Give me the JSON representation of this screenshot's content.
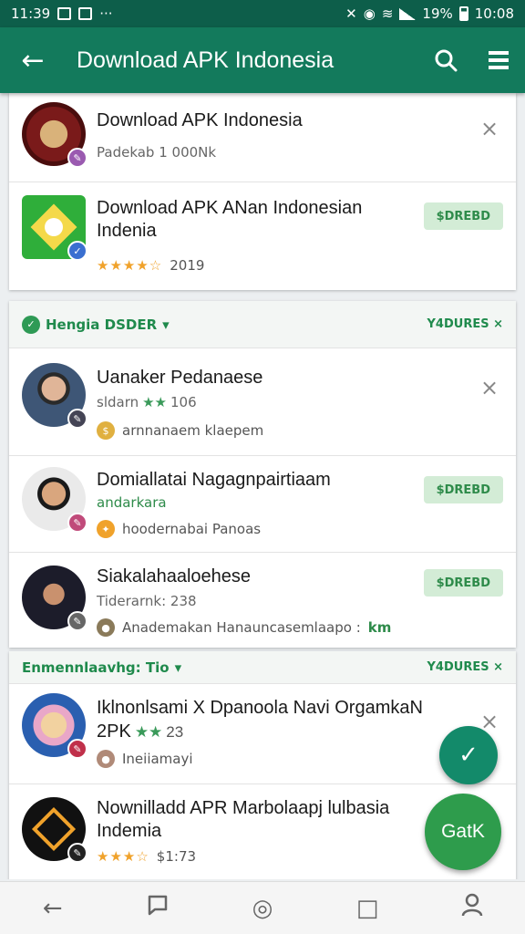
{
  "status": {
    "time": "11:39",
    "more": "···",
    "battery": "19%",
    "time_right": "10:08"
  },
  "appbar": {
    "back": "←",
    "title": "Download APK Indonesia",
    "search_icon": "search-icon",
    "menu_icon": "menu-icon"
  },
  "top_items": [
    {
      "title": "Download APK Indonesia",
      "sub": "Padekab 1 000Nk",
      "action": "×"
    },
    {
      "title": "Download APK ANan Indonesian Indenia",
      "rating_text": "2019",
      "action": "$DREBD"
    }
  ],
  "section1": {
    "label": "Hengia DSDER",
    "more": "Y4DURES ×",
    "items": [
      {
        "title": "Uanaker Pedanaese",
        "sub": "sldarn",
        "count": "106",
        "meta": "arnnanaem klaepem",
        "action": "×"
      },
      {
        "title": "Domiallatai Nagagnpairtiaam",
        "sub": "andarkara",
        "meta": "hoodernabai Panoas",
        "action": "$DREBD"
      },
      {
        "title": "Siakalahaaloehese",
        "sub": "Tiderarnk: 238",
        "meta": "Anademakan Hanauncasemlaapo :",
        "meta_green": "km",
        "action": "$DREBD"
      }
    ]
  },
  "section2": {
    "label": "Enmennlaavhg: Tio",
    "more": "Y4DURES ×",
    "items": [
      {
        "title": "Iklnonlsami X Dpanoola Navi OrgamkaN",
        "sub": "2PK",
        "count": "23",
        "meta": "Ineiiamayi",
        "action": "×"
      },
      {
        "title": "Nownilladd APR Marbolaapj lulbasia Indemia",
        "rating_text": "$1:73",
        "action": "×"
      }
    ]
  },
  "fab": {
    "check": "✓",
    "label": "GatK"
  },
  "navbar": {
    "back": "←",
    "home": "◎",
    "recents": "□"
  },
  "colors": {
    "primary": "#137a5c",
    "status": "#0d5e4a",
    "accent": "#2e9c4c",
    "star": "#f0a22b"
  }
}
